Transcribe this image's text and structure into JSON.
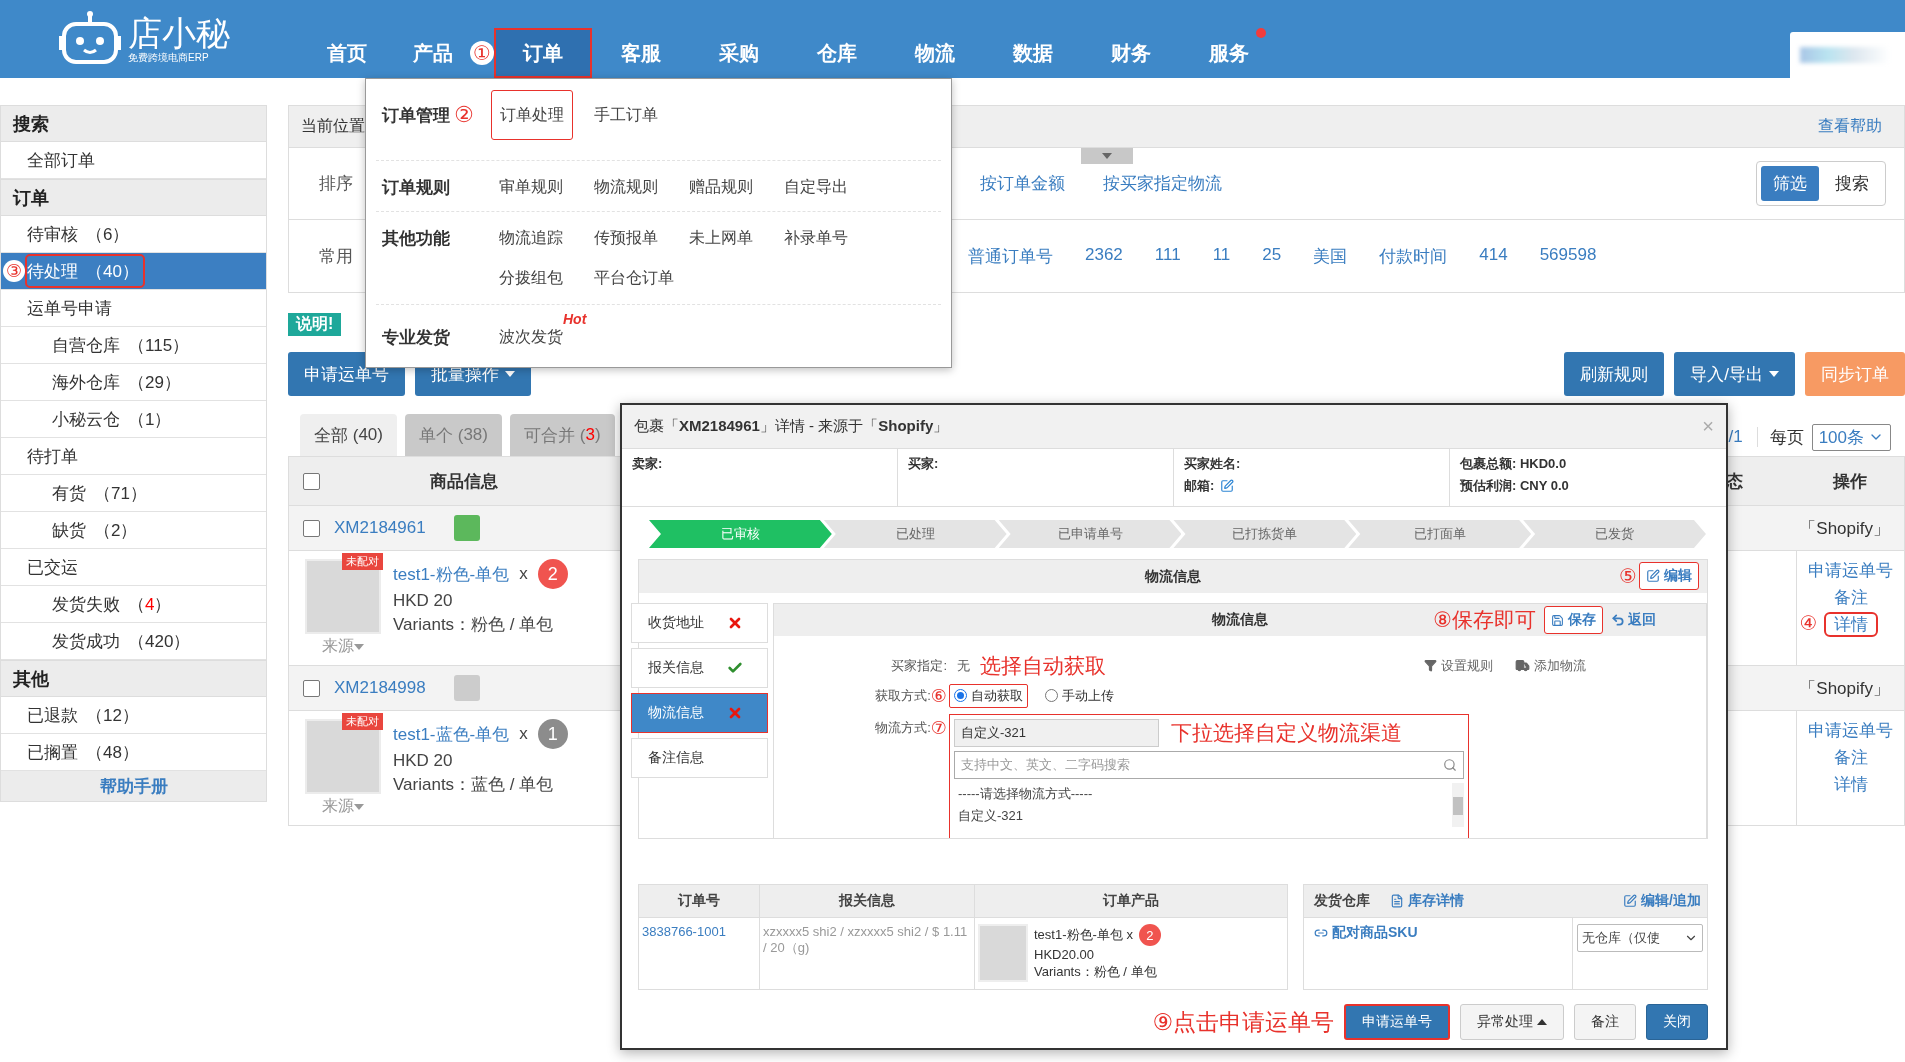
{
  "header": {
    "logo": {
      "title": "店小秘",
      "subtitle": "免费跨境电商ERP"
    },
    "nav": [
      {
        "label": "首页",
        "selected": false,
        "boxed": false
      },
      {
        "label": "产品",
        "selected": false,
        "boxed": false,
        "callout": "①"
      },
      {
        "label": "订单",
        "selected": true,
        "boxed": true
      },
      {
        "label": "客服",
        "selected": false,
        "boxed": false
      },
      {
        "label": "采购",
        "selected": false,
        "boxed": false
      },
      {
        "label": "仓库",
        "selected": false,
        "boxed": false
      },
      {
        "label": "物流",
        "selected": false,
        "boxed": false
      },
      {
        "label": "数据",
        "selected": false,
        "boxed": false
      },
      {
        "label": "财务",
        "selected": false,
        "boxed": false
      },
      {
        "label": "服务",
        "selected": false,
        "boxed": false,
        "dot": true
      }
    ]
  },
  "sidebar": {
    "sections": [
      {
        "title": "搜索",
        "items": [
          {
            "label": "全部订单",
            "selected": false,
            "boxed": false
          }
        ]
      },
      {
        "title": "订单",
        "items": [
          {
            "label": "待审核",
            "count": [
              "（",
              "6",
              "）"
            ],
            "alert": false,
            "selected": false,
            "boxed": false
          },
          {
            "label": "待处理",
            "count": [
              "（",
              "40",
              "）"
            ],
            "alert": false,
            "selected": true,
            "boxed": true,
            "callout": "③"
          },
          {
            "label": "运单号申请",
            "selected": false,
            "boxed": false,
            "children": [
              {
                "label": "自营仓库",
                "count": [
                  "（",
                  "115",
                  "）"
                ],
                "alert": false,
                "selected": false,
                "boxed": false
              },
              {
                "label": "海外仓库",
                "count": [
                  "（",
                  "29",
                  "）"
                ],
                "alert": false,
                "selected": false,
                "boxed": false
              },
              {
                "label": "小秘云仓",
                "count": [
                  "（",
                  "1",
                  "）"
                ],
                "alert": false,
                "selected": false,
                "boxed": false
              }
            ]
          },
          {
            "label": "待打单",
            "selected": false,
            "boxed": false,
            "children": [
              {
                "label": "有货",
                "count": [
                  "（",
                  "71",
                  "）"
                ],
                "alert": false,
                "selected": false,
                "boxed": false
              },
              {
                "label": "缺货",
                "count": [
                  "（",
                  "2",
                  "）"
                ],
                "alert": false,
                "selected": false,
                "boxed": false
              }
            ]
          },
          {
            "label": "已交运",
            "selected": false,
            "boxed": false,
            "children": [
              {
                "label": "发货失败",
                "count": [
                  "（",
                  "4",
                  "）"
                ],
                "alert": true,
                "selected": false,
                "boxed": false
              },
              {
                "label": "发货成功",
                "count": [
                  "（",
                  "420",
                  "）"
                ],
                "alert": false,
                "selected": false,
                "boxed": false
              }
            ]
          }
        ]
      },
      {
        "title": "其他",
        "items": [
          {
            "label": "已退款",
            "count": [
              "（",
              "12",
              "）"
            ],
            "alert": false,
            "selected": false,
            "boxed": false
          },
          {
            "label": "已搁置",
            "count": [
              "（",
              "48",
              "）"
            ],
            "alert": false,
            "selected": false,
            "boxed": false
          }
        ]
      }
    ],
    "help_link": "帮助手册"
  },
  "breadcrumb": {
    "label": "当前位置",
    "help": "查看帮助"
  },
  "filters": {
    "rows": [
      {
        "label": "排序",
        "options": [
          "按订单金额",
          "按买家指定物流"
        ]
      },
      {
        "label": "常用",
        "options": [
          "普通订单号",
          "2362",
          "111",
          "11",
          "25",
          "美国",
          "付款时间",
          "414",
          "569598"
        ]
      }
    ],
    "modes": [
      {
        "label": "筛选",
        "selected": true
      },
      {
        "label": "搜索",
        "selected": false
      }
    ]
  },
  "notice_tag": "说明!",
  "actions": {
    "left": [
      {
        "label": "申请运单号",
        "caret": false
      },
      {
        "label": "批量操作",
        "caret": true
      }
    ],
    "right": [
      {
        "label": "刷新规则",
        "kind": "primary",
        "caret": false
      },
      {
        "label": "导入/导出",
        "kind": "primary",
        "caret": true
      },
      {
        "label": "同步订单",
        "kind": "warning",
        "caret": false
      }
    ]
  },
  "tabs": [
    {
      "label": "全部",
      "count": [
        "(",
        "40",
        ")"
      ],
      "alert": false,
      "selected": true
    },
    {
      "label": "单个",
      "count": [
        "(",
        "38",
        ")"
      ],
      "alert": false,
      "selected": false
    },
    {
      "label": "可合并",
      "count": [
        "(",
        "3",
        ")"
      ],
      "alert": true,
      "selected": false
    }
  ],
  "pagination": {
    "pages": "/1",
    "per_page_label": "每页",
    "per_page": "100条"
  },
  "table": {
    "columns": [
      "商品信息",
      "态",
      "操作"
    ],
    "select_all": false,
    "orders": [
      {
        "order_no": "XM2184961",
        "checked": false,
        "color": "#5cb85c",
        "platform": "「Shopify」",
        "product": {
          "tag": "未配对",
          "name": "test1-粉色-单包",
          "times": "x",
          "qty": {
            "text": "2",
            "color": "#f0544f"
          },
          "price": "HKD 20",
          "variants": "Variants：粉色 / 单包",
          "source": "来源"
        },
        "ops": [
          {
            "label": "申请运单号",
            "boxed": false
          },
          {
            "label": "备注",
            "boxed": false
          },
          {
            "label": "详情",
            "boxed": true,
            "callout": "④"
          }
        ]
      },
      {
        "order_no": "XM2184998",
        "checked": false,
        "color": "#cccccc",
        "platform": "「Shopify」",
        "product": {
          "tag": "未配对",
          "name": "test1-蓝色-单包",
          "times": "x",
          "qty": {
            "text": "1",
            "color": "#8c8c8c"
          },
          "price": "HKD 20",
          "variants": "Variants：蓝色 / 单包",
          "source": "来源"
        },
        "ops": [
          {
            "label": "申请运单号",
            "boxed": false
          },
          {
            "label": "备注",
            "boxed": false
          },
          {
            "label": "详情",
            "boxed": false
          }
        ]
      }
    ]
  },
  "order_menu": {
    "groups": [
      {
        "title": "订单管理",
        "callout": "②",
        "items": [
          {
            "label": "订单处理",
            "boxed": true
          },
          {
            "label": "手工订单",
            "boxed": false
          }
        ]
      },
      {
        "title": "订单规则",
        "items": [
          {
            "label": "审单规则",
            "boxed": false
          },
          {
            "label": "物流规则",
            "boxed": false
          },
          {
            "label": "赠品规则",
            "boxed": false
          },
          {
            "label": "自定导出",
            "boxed": false
          }
        ]
      },
      {
        "title": "其他功能",
        "items": [
          {
            "label": "物流追踪",
            "boxed": false
          },
          {
            "label": "传预报单",
            "boxed": false
          },
          {
            "label": "未上网单",
            "boxed": false
          },
          {
            "label": "补录单号",
            "boxed": false
          },
          {
            "label": "分拨组包",
            "boxed": false
          },
          {
            "label": "平台仓订单",
            "boxed": false
          }
        ]
      },
      {
        "title": "专业发货",
        "items": [
          {
            "label": "波次发货",
            "boxed": false,
            "badge": "Hot"
          }
        ]
      }
    ]
  },
  "detail_dialog": {
    "title": "包裹「**XM2184961**」详情 - 来源于「**Shopify**」",
    "close": "×",
    "info": [
      {
        "fields": [
          {
            "label": "卖家:"
          }
        ]
      },
      {
        "fields": [
          {
            "label": "买家:"
          }
        ]
      },
      {
        "fields": [
          {
            "label": "买家姓名:"
          },
          {
            "label": "邮箱:",
            "edit_icon": true
          }
        ]
      },
      {
        "fields": [
          {
            "label": "包裹总额:",
            "value": "HKD0.0"
          },
          {
            "label": "预估利润:",
            "value": "CNY 0.0"
          }
        ]
      }
    ],
    "steps": [
      {
        "label": "已审核",
        "done": true
      },
      {
        "label": "已处理",
        "done": false
      },
      {
        "label": "已申请单号",
        "done": false
      },
      {
        "label": "已打拣货单",
        "done": false
      },
      {
        "label": "已打面单",
        "done": false
      },
      {
        "label": "已发货",
        "done": false
      }
    ],
    "logistics": {
      "title": "物流信息",
      "callout": "⑤",
      "edit": "编辑",
      "tabs": [
        {
          "label": "收货地址",
          "kind": "error",
          "selected": false,
          "boxed": false
        },
        {
          "label": "报关信息",
          "kind": "ok",
          "selected": false,
          "boxed": false
        },
        {
          "label": "物流信息",
          "kind": "error",
          "selected": true,
          "boxed": true
        },
        {
          "label": "备注信息",
          "kind": "plain",
          "selected": false,
          "boxed": false
        }
      ],
      "panel": {
        "title": "物流信息",
        "note": "⑧保存即可",
        "save": "保存",
        "back": "返回",
        "buyer_label": "买家指定:",
        "buyer_value": "无",
        "buyer_note": "选择自动获取",
        "tools": [
          {
            "label": "设置规则",
            "kind": "rule"
          },
          {
            "label": "添加物流",
            "kind": "add"
          }
        ],
        "fetch_label": "获取方式:",
        "fetch_callout": "⑥",
        "fetch_options": [
          {
            "label": "自动获取",
            "selected": true,
            "boxed": true
          },
          {
            "label": "手动上传",
            "selected": false,
            "boxed": false
          }
        ],
        "method_label": "物流方式:",
        "method_callout": "⑦",
        "method_value": "自定义-321",
        "method_note": "下拉选择自定义物流渠道",
        "search_placeholder": "支持中文、英文、二字码搜索",
        "options": [
          "-----请选择物流方式-----",
          "自定义-321"
        ]
      }
    },
    "orders_table": {
      "columns": [
        "订单号",
        "报关信息",
        "订单产品"
      ],
      "rows": [
        {
          "order_no": "3838766-1001",
          "customs": "xzxxxx5 shi2 / xzxxxx5 shi2 / $ 1.11 / 20（g)",
          "product": {
            "name": "test1-粉色-单包 x",
            "qty": {
              "text": "2",
              "color": "#f0544f"
            },
            "price": "HKD20.00",
            "variants": "Variants：粉色 / 单包"
          }
        }
      ]
    },
    "warehouse": {
      "title": "发货仓库",
      "stock_link": "库存详情",
      "edit_link": "编辑/追加",
      "pair_link": "配对商品SKU",
      "select": "无仓库（仅使"
    },
    "footer": {
      "note": "⑨点击申请运单号",
      "buttons": [
        {
          "label": "申请运单号",
          "kind": "primary",
          "boxed": true,
          "caret": false
        },
        {
          "label": "异常处理",
          "kind": "default",
          "boxed": false,
          "caret": true
        },
        {
          "label": "备注",
          "kind": "default",
          "boxed": false,
          "caret": false
        },
        {
          "label": "关闭",
          "kind": "primary",
          "boxed": false,
          "caret": false
        }
      ]
    }
  }
}
